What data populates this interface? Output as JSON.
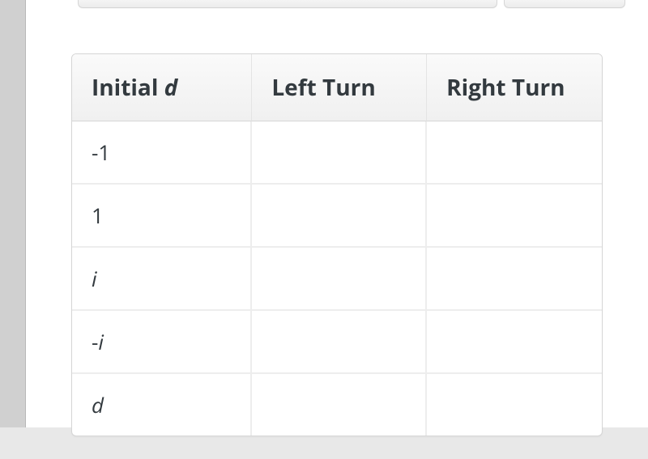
{
  "table": {
    "headers": {
      "c1_prefix": "Initial ",
      "c1_var": "d",
      "c2": "Left Turn",
      "c3": "Right Turn"
    },
    "rows": [
      {
        "c1_plain": "-1",
        "c1_var": "",
        "c2": "",
        "c3": ""
      },
      {
        "c1_plain": "1",
        "c1_var": "",
        "c2": "",
        "c3": ""
      },
      {
        "c1_plain": "",
        "c1_var": "i",
        "c2": "",
        "c3": ""
      },
      {
        "c1_plain": "-",
        "c1_var": "i",
        "c2": "",
        "c3": ""
      },
      {
        "c1_plain": "",
        "c1_var": "d",
        "c2": "",
        "c3": ""
      }
    ]
  }
}
